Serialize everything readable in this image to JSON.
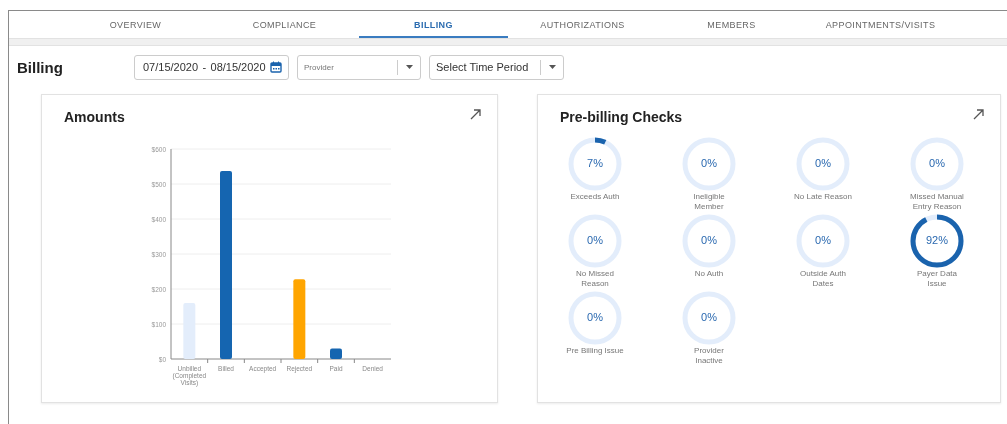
{
  "tabs": [
    {
      "label": "OVERVIEW",
      "selected": false
    },
    {
      "label": "COMPLIANCE",
      "selected": false
    },
    {
      "label": "BILLING",
      "selected": true
    },
    {
      "label": "AUTHORIZATIONS",
      "selected": false
    },
    {
      "label": "MEMBERS",
      "selected": false
    },
    {
      "label": "APPOINTMENTS/VISITS",
      "selected": false
    }
  ],
  "page_title": "Billing",
  "filters": {
    "date_from": "07/15/2020",
    "date_separator": "-",
    "date_to": "08/15/2020",
    "provider": {
      "placeholder": "Provider"
    },
    "time_period": {
      "value": "Select Time Period"
    }
  },
  "amounts_card": {
    "title": "Amounts",
    "chart_data": {
      "type": "bar",
      "categories": [
        "Unbilled (Completed Visits)",
        "Billed",
        "Accepted",
        "Rejected",
        "Paid",
        "Denied"
      ],
      "grid": true,
      "series": [
        {
          "color": "#e3edfb",
          "values": [
            160,
            null,
            null,
            null,
            null,
            null
          ]
        },
        {
          "color": "#1565b0",
          "values": [
            null,
            537,
            0,
            null,
            30,
            0
          ]
        },
        {
          "color": "#ffa500",
          "values": [
            null,
            null,
            null,
            228,
            null,
            null
          ]
        }
      ],
      "ylim": [
        0,
        600
      ],
      "yticks": [
        {
          "value": 0,
          "label": "$0"
        },
        {
          "value": 100,
          "label": "$100"
        },
        {
          "value": 200,
          "label": "$200"
        },
        {
          "value": 300,
          "label": "$300"
        },
        {
          "value": 400,
          "label": "$400"
        },
        {
          "value": 500,
          "label": "$500"
        },
        {
          "value": 600,
          "label": "$600"
        }
      ]
    }
  },
  "checks_card": {
    "title": "Pre-billing Checks",
    "items": [
      {
        "label": "Exceeds Auth",
        "value": "7%"
      },
      {
        "label": "Ineligible Member",
        "value": "0%"
      },
      {
        "label": "No Late Reason",
        "value": "0%"
      },
      {
        "label": "Missed Manual Entry Reason",
        "value": "0%"
      },
      {
        "label": "No Missed Reason",
        "value": "0%"
      },
      {
        "label": "No Auth",
        "value": "0%"
      },
      {
        "label": "Outside Auth Dates",
        "value": "0%"
      },
      {
        "label": "Payer Data Issue",
        "value": "92%"
      },
      {
        "label": "Pre Billing Issue",
        "value": "0%"
      },
      {
        "label": "Provider Inactive",
        "value": "0%"
      }
    ]
  }
}
